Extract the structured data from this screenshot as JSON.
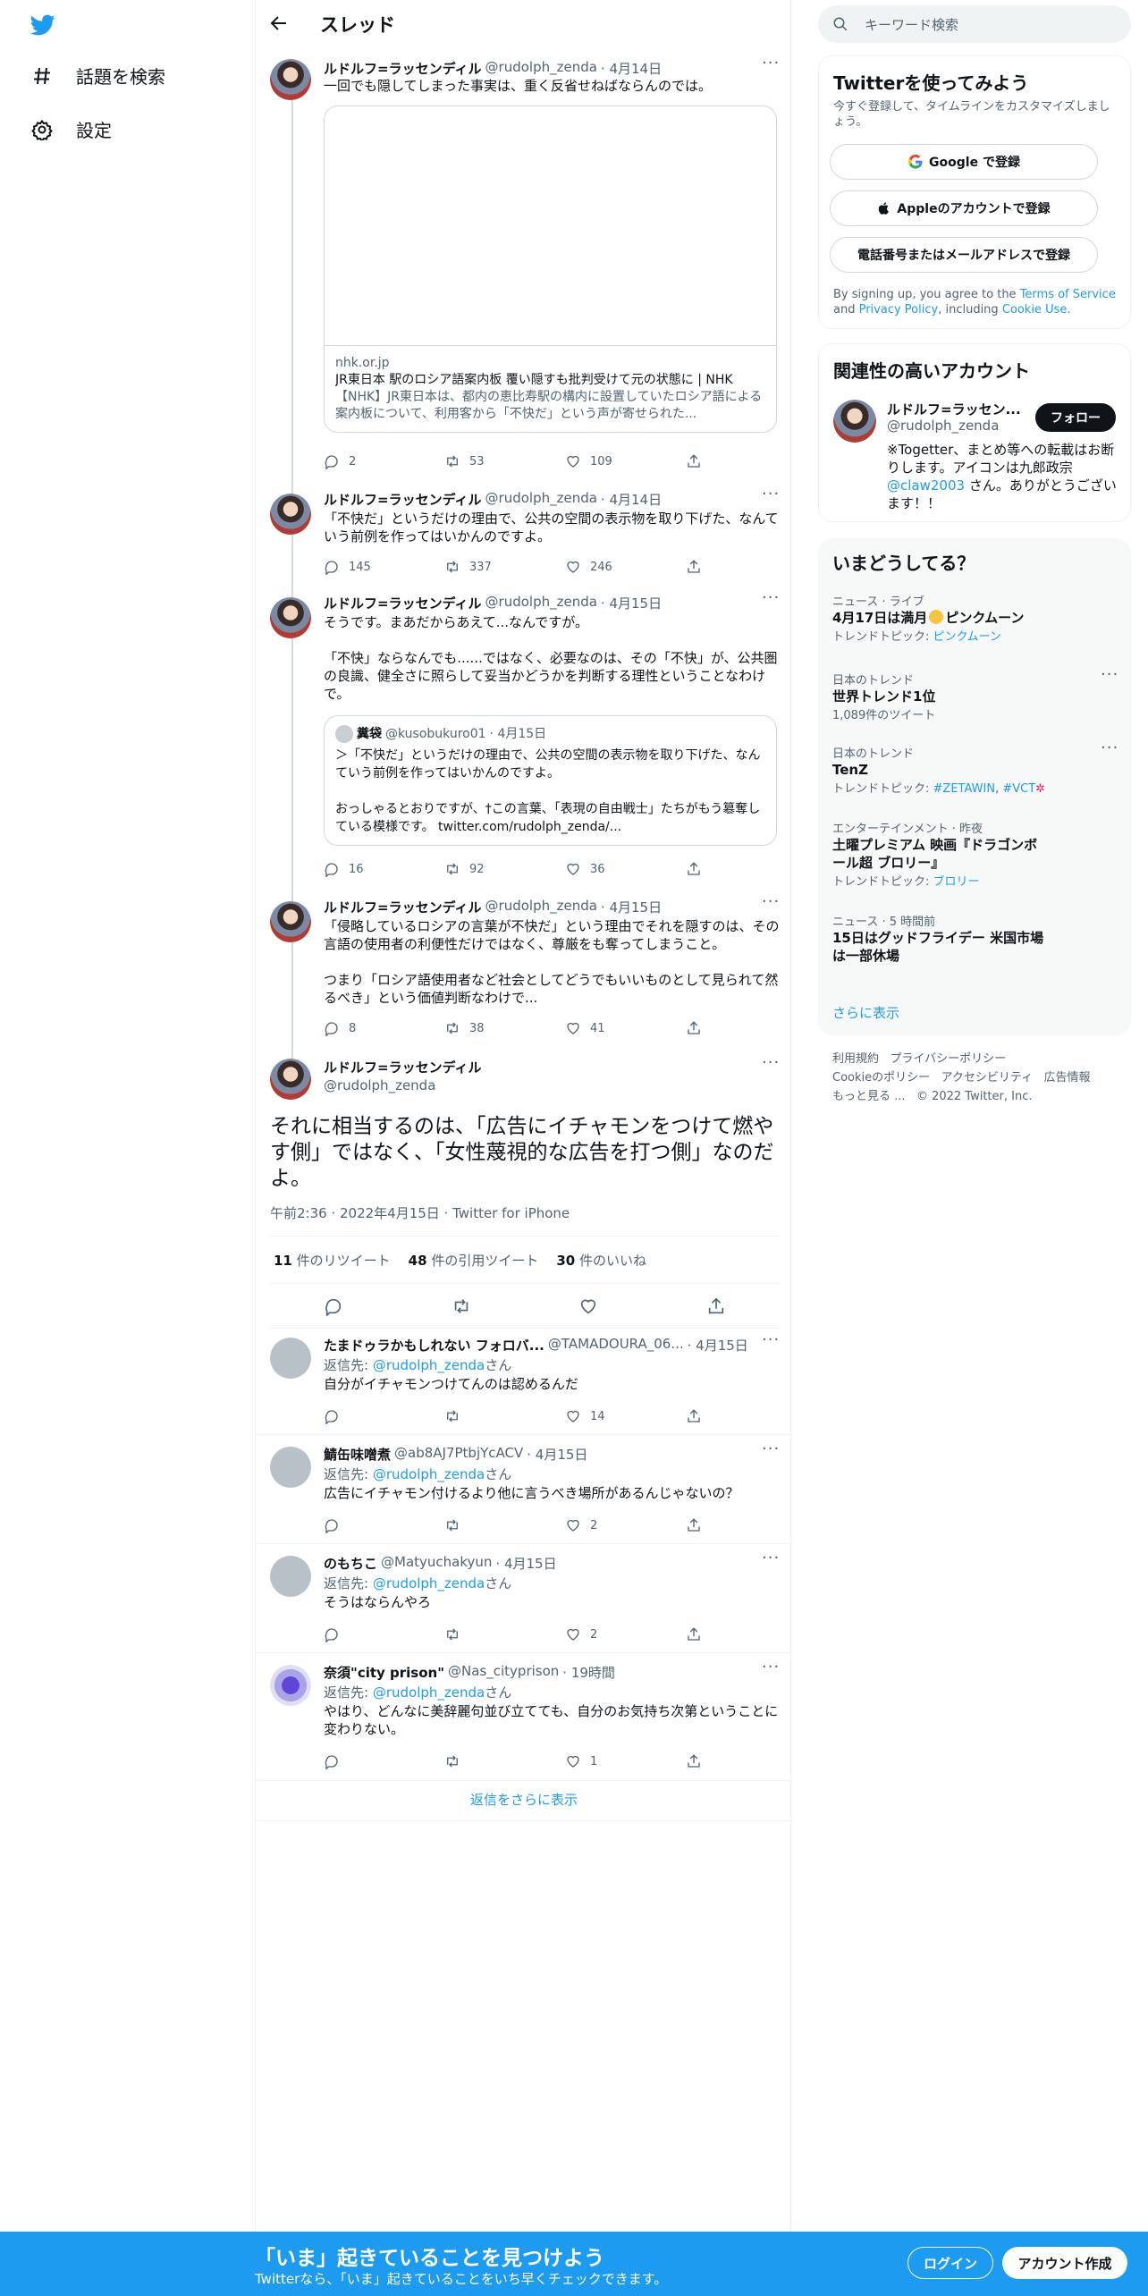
{
  "nav": {
    "explore_label": "話題を検索",
    "settings_label": "設定"
  },
  "header": {
    "title": "スレッド"
  },
  "tweets": [
    {
      "name": "ルドルフ=ラッセンディル",
      "handle": "@rudolph_zenda",
      "date": "· 4月14日",
      "text": "一回でも隠してしまった事実は、重く反省せねばならんのでは。",
      "card": {
        "domain": "nhk.or.jp",
        "title": "JR東日本 駅のロシア語案内板 覆い隠すも批判受けて元の状態に | NHK",
        "desc": "【NHK】JR東日本は、都内の恵比寿駅の構内に設置していたロシア語による案内板について、利用客から「不快だ」という声が寄せられた..."
      },
      "replies": "2",
      "retweets": "53",
      "likes": "109"
    },
    {
      "name": "ルドルフ=ラッセンディル",
      "handle": "@rudolph_zenda",
      "date": "· 4月14日",
      "text": "「不快だ」というだけの理由で、公共の空間の表示物を取り下げた、なんていう前例を作ってはいかんのですよ。",
      "replies": "145",
      "retweets": "337",
      "likes": "246"
    },
    {
      "name": "ルドルフ=ラッセンディル",
      "handle": "@rudolph_zenda",
      "date": "· 4月15日",
      "text": "そうです。まあだからあえて...なんですが。\n\n「不快」ならなんでも......ではなく、必要なのは、その「不快」が、公共圏の良識、健全さに照らして妥当かどうかを判断する理性ということなわけで。",
      "quote": {
        "name": "糞袋",
        "handle": "@kusobukuro01",
        "date": "· 4月15日",
        "text": "＞「不快だ」というだけの理由で、公共の空間の表示物を取り下げた、なんていう前例を作ってはいかんのですよ。\n\nおっしゃるとおりですが、†この言葉、「表現の自由戦士」たちがもう簒奪している模様です。 twitter.com/rudolph_zenda/..."
      },
      "replies": "16",
      "retweets": "92",
      "likes": "36"
    },
    {
      "name": "ルドルフ=ラッセンディル",
      "handle": "@rudolph_zenda",
      "date": "· 4月15日",
      "text": "「侵略しているロシアの言葉が不快だ」という理由でそれを隠すのは、その言語の使用者の利便性だけではなく、尊厳をも奪ってしまうこと。\n\nつまり「ロシア語使用者など社会としてどうでもいいものとして見られて然るべき」という価値判断なわけで...",
      "replies": "8",
      "retweets": "38",
      "likes": "41"
    }
  ],
  "main_tweet": {
    "name": "ルドルフ=ラッセンディル",
    "handle": "@rudolph_zenda",
    "text": "それに相当するのは、「広告にイチャモンをつけて燃やす側」ではなく、「女性蔑視的な広告を打つ側」なのだよ。",
    "meta": "午前2:36 · 2022年4月15日 · Twitter for iPhone",
    "retweets_count": "11",
    "retweets_label": "件のリツイート",
    "quotes_count": "48",
    "quotes_label": "件の引用ツイート",
    "likes_count": "30",
    "likes_label": "件のいいね"
  },
  "replies": [
    {
      "name": "たまドゥラかもしれない フォロバ...",
      "handle": "@TAMADOURA_06...",
      "date": "· 4月15日",
      "reply_prefix": "返信先: ",
      "reply_to": "@rudolph_zenda",
      "reply_suffix": "さん",
      "text": "自分がイチャモンつけてんのは認めるんだ",
      "likes": "14"
    },
    {
      "name": "鯖缶味噌煮",
      "handle": "@ab8AJ7PtbjYcACV",
      "date": "· 4月15日",
      "reply_prefix": "返信先: ",
      "reply_to": "@rudolph_zenda",
      "reply_suffix": "さん",
      "text": "広告にイチャモン付けるより他に言うべき場所があるんじゃないの？",
      "likes": "2"
    },
    {
      "name": "のもちこ",
      "handle": "@Matyuchakyun",
      "date": "· 4月15日",
      "reply_prefix": "返信先: ",
      "reply_to": "@rudolph_zenda",
      "reply_suffix": "さん",
      "text": "そうはならんやろ",
      "likes": "2"
    },
    {
      "name": "奈須\"city prison\"",
      "handle": "@Nas_cityprison",
      "date": "· 19時間",
      "reply_prefix": "返信先: ",
      "reply_to": "@rudolph_zenda",
      "reply_suffix": "さん",
      "text": "やはり、どんなに美辞麗句並び立てても、自分のお気持ち次第ということに変わりない。",
      "likes": "1"
    }
  ],
  "show_more_replies": "返信をさらに表示",
  "search": {
    "placeholder": "キーワード検索"
  },
  "signup_panel": {
    "title": "Twitterを使ってみよう",
    "subtitle": "今すぐ登録して、タイムラインをカスタマイズしましょう。",
    "google_label": "Google で登録",
    "apple_label": "Appleのアカウントで登録",
    "phone_label": "電話番号またはメールアドレスで登録",
    "terms_prefix": "By signing up, you agree to the ",
    "terms_link": "Terms of Service",
    "terms_and": " and ",
    "privacy_link": "Privacy Policy",
    "terms_including": ", including ",
    "cookie_link": "Cookie Use."
  },
  "related_panel": {
    "title": "関連性の高いアカウント",
    "name": "ルドルフ=ラッセン...",
    "handle": "@rudolph_zenda",
    "follow_label": "フォロー",
    "bio_1": "※Togetter、まとめ等への転載はお断りします。アイコンは九郎政宗",
    "bio_link": "@claw2003",
    "bio_2": " さん。ありがとうございます！！"
  },
  "trends_panel": {
    "title": "いまどうしてる？",
    "items": [
      {
        "meta": "ニュース · ライブ",
        "title": "4月17日は満月",
        "title_suffix": "ピンクムーン",
        "sub_prefix": "トレンドトピック: ",
        "sub_link": "ピンクムーン"
      },
      {
        "meta": "日本のトレンド",
        "title": "世界トレンド1位",
        "sub": "1,089件のツイート"
      },
      {
        "meta": "日本のトレンド",
        "title": "TenZ",
        "sub_prefix": "トレンドトピック: ",
        "sub_link": "#ZETAWIN",
        "sub_link2": "#VCT"
      },
      {
        "meta": "エンターテインメント · 昨夜",
        "title": "土曜プレミアム 映画『ドラゴンボール超 ブロリー』",
        "sub_prefix": "トレンドトピック: ",
        "sub_link": "ブロリー"
      },
      {
        "meta": "ニュース · 5 時間前",
        "title": "15日はグッドフライデー 米国市場は一部休場"
      }
    ],
    "show_more": "さらに表示"
  },
  "footer": {
    "terms": "利用規約",
    "privacy": "プライバシーポリシー",
    "cookie": "Cookieのポリシー",
    "accessibility": "アクセシビリティ",
    "ads": "広告情報",
    "more": "もっと見る ...",
    "copyright": "© 2022 Twitter, Inc."
  },
  "bottom_bar": {
    "title": "「いま」起きていることを見つけよう",
    "subtitle": "Twitterなら、「いま」起きていることをいち早くチェックできます。",
    "login_label": "ログイン",
    "signup_label": "アカウント作成"
  },
  "colors": {
    "accent": "#1d9bf0",
    "text": "#0f1419",
    "muted": "#536471",
    "border": "#eff3f4"
  }
}
